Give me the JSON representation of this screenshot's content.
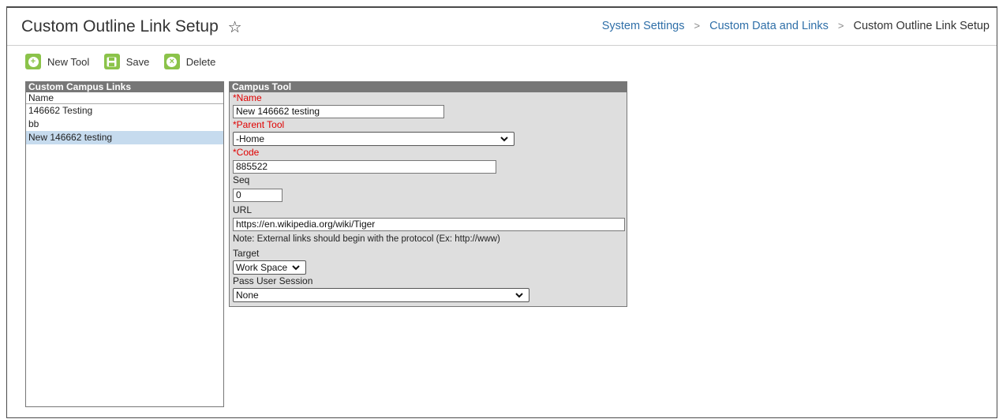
{
  "header": {
    "title": "Custom Outline Link Setup",
    "breadcrumb": [
      "System Settings",
      "Custom Data and Links",
      "Custom Outline Link Setup"
    ]
  },
  "toolbar": {
    "new_tool_label": "New Tool",
    "save_label": "Save",
    "delete_label": "Delete"
  },
  "left_panel": {
    "title": "Custom Campus Links",
    "column_header": "Name",
    "items": [
      "146662 Testing",
      "bb",
      "New 146662 testing"
    ],
    "selected_index": 2
  },
  "form": {
    "title": "Campus Tool",
    "name_label": "*Name",
    "name_value": "New 146662 testing",
    "parent_tool_label": "*Parent Tool",
    "parent_tool_value": "-Home",
    "code_label": "*Code",
    "code_value": "885522",
    "seq_label": "Seq",
    "seq_value": "0",
    "url_label": "URL",
    "url_value": "https://en.wikipedia.org/wiki/Tiger",
    "url_note": "Note: External links should begin with the protocol (Ex: http://www)",
    "target_label": "Target",
    "target_value": "Work Space",
    "pass_session_label": "Pass User Session",
    "pass_session_value": "None"
  },
  "colors": {
    "accent_green": "#8bc34a",
    "link_blue": "#2f6fa8",
    "required_red": "#e00000",
    "selected_row": "#c6dbee",
    "panel_header": "#777777"
  },
  "icons": {
    "new_tool": "plus-circle-icon",
    "save": "save-icon",
    "delete": "close-circle-icon",
    "favorite": "star-outline-icon",
    "breadcrumb_separator": "chevron-right-icon",
    "dropdown": "chevron-down-icon"
  }
}
